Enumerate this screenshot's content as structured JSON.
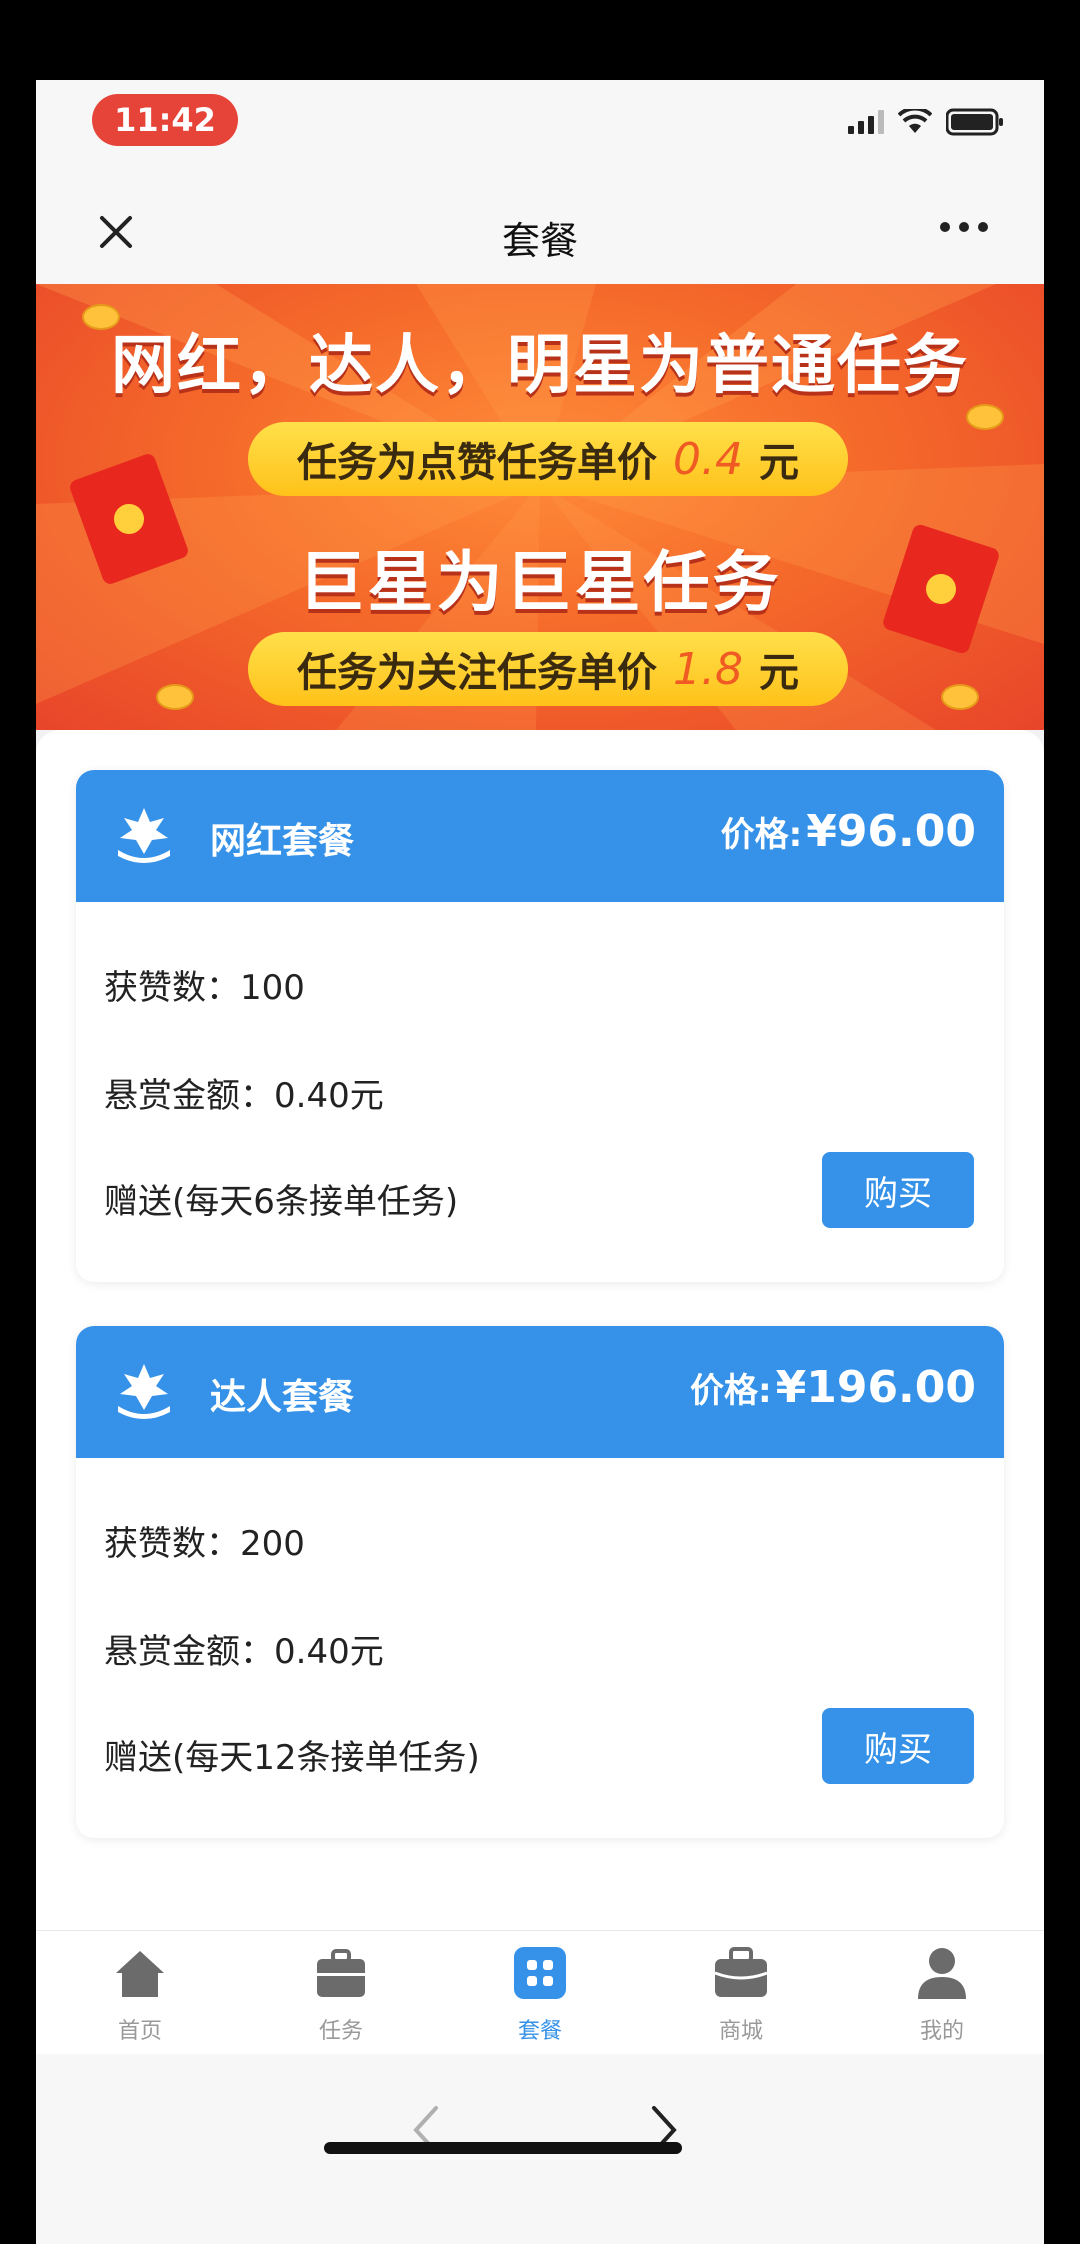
{
  "status_bar": {
    "time": "11:42"
  },
  "nav": {
    "title": "套餐"
  },
  "banner": {
    "line1": "网红，达人，明星为普通任务",
    "pill1_prefix": "任务为点赞任务单价",
    "pill1_value": "0.4",
    "pill1_unit": "元",
    "line3": "巨星为巨星任务",
    "pill2_prefix": "任务为关注任务单价",
    "pill2_value": "1.8",
    "pill2_unit": "元"
  },
  "packages": [
    {
      "name": "网红套餐",
      "price_label": "价格:",
      "price": "¥96.00",
      "likes": "获赞数：100",
      "reward": "悬赏金额：0.40元",
      "bonus": "赠送(每天6条接单任务)",
      "buy_label": "购买"
    },
    {
      "name": "达人套餐",
      "price_label": "价格:",
      "price": "¥196.00",
      "likes": "获赞数：200",
      "reward": "悬赏金额：0.40元",
      "bonus": "赠送(每天12条接单任务)",
      "buy_label": "购买"
    }
  ],
  "tabbar": {
    "items": [
      {
        "label": "首页",
        "icon": "home-icon"
      },
      {
        "label": "任务",
        "icon": "briefcase-icon"
      },
      {
        "label": "套餐",
        "icon": "grid-icon",
        "active": true
      },
      {
        "label": "商城",
        "icon": "shop-icon"
      },
      {
        "label": "我的",
        "icon": "user-icon"
      }
    ]
  },
  "colors": {
    "accent": "#3592e8",
    "banner": "#f56a2a",
    "pill": "#ffd23a",
    "time_pill": "#e64438"
  }
}
